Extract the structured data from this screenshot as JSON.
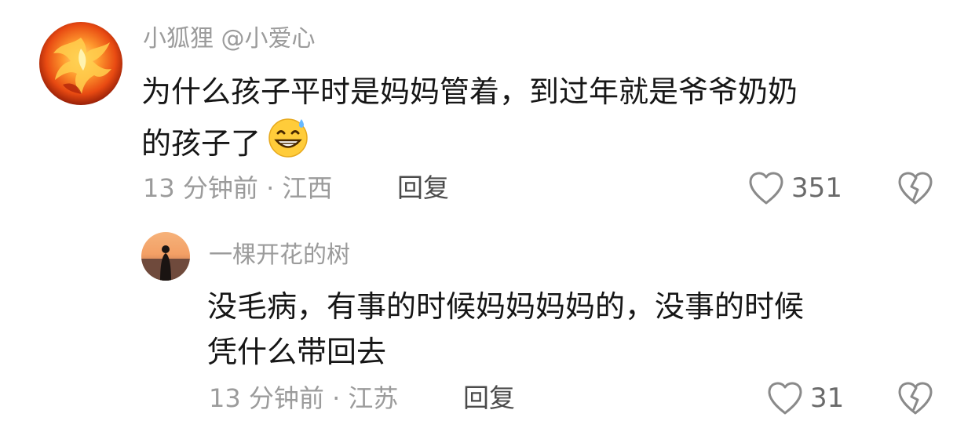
{
  "comment": {
    "username": "小狐狸 @小爱心",
    "text_line1": "为什么孩子平时是妈妈管着，到过年就是爷爷奶奶",
    "text_line2": "的孩子了",
    "emoji": "grinning-sweat-emoji",
    "time_location": "13 分钟前 · 江西",
    "reply_label": "回复",
    "likes": "351"
  },
  "reply": {
    "username": "一棵开花的树",
    "text_line1": "没毛病，有事的时候妈妈妈妈的，没事的时候",
    "text_line2": "凭什么带回去",
    "time_location": "13 分钟前 · 江苏",
    "reply_label": "回复",
    "likes": "31"
  },
  "colors": {
    "meta_gray": "#9b9b9b",
    "text_dark": "#161616",
    "phoenix_orange": "#f26b1d"
  }
}
